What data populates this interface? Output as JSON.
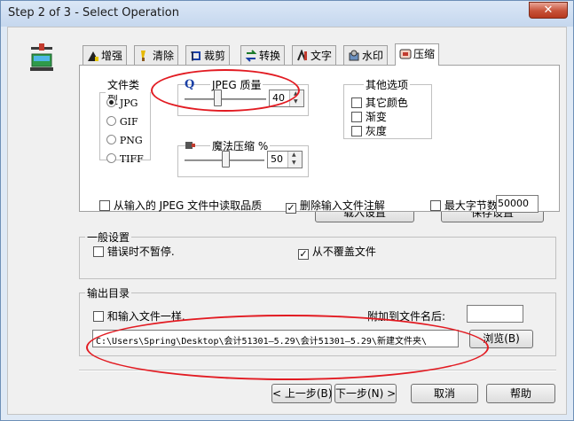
{
  "window": {
    "title": "Step 2 of 3 - Select Operation",
    "close_label": "✕"
  },
  "tabs": [
    {
      "label": "增强",
      "icon": "enhance-icon"
    },
    {
      "label": "清除",
      "icon": "brush-icon"
    },
    {
      "label": "裁剪",
      "icon": "crop-icon"
    },
    {
      "label": "转换",
      "icon": "convert-icon"
    },
    {
      "label": "文字",
      "icon": "text-icon"
    },
    {
      "label": "水印",
      "icon": "watermark-icon"
    },
    {
      "label": "压缩",
      "icon": "compress-icon",
      "active": true
    }
  ],
  "file_type": {
    "legend": "文件类型",
    "options": [
      "JPG",
      "GIF",
      "PNG",
      "TIFF"
    ],
    "selected": "JPG"
  },
  "jpeg_quality": {
    "label": "JPEG 质量",
    "icon_glyph": "Q",
    "value": "40",
    "level_fraction": 0.4
  },
  "magic_compress": {
    "label": "魔法压缩 %",
    "value": "50",
    "level_fraction": 0.5
  },
  "other_options": {
    "legend": "其他选项",
    "items": [
      {
        "label": "其它颜色",
        "checked": false
      },
      {
        "label": "渐变",
        "checked": false
      },
      {
        "label": "灰度",
        "checked": false
      }
    ]
  },
  "read_quality": {
    "label": "从输入的 JPEG 文件中读取品质",
    "checked": false
  },
  "remove_comments": {
    "label": "删除输入文件注解",
    "checked": true
  },
  "max_bytes": {
    "label": "最大字节数",
    "value": "50000",
    "checked": false
  },
  "buttons": {
    "load_settings": "载入设置",
    "save_settings": "保存设置"
  },
  "general": {
    "legend": "一般设置",
    "no_pause": {
      "label": "错误时不暂停.",
      "checked": false
    },
    "no_overwrite": {
      "label": "从不覆盖文件",
      "checked": true
    }
  },
  "output": {
    "legend": "输出目录",
    "same_as_input": {
      "label": "和输入文件一样.",
      "checked": false
    },
    "append_label": "附加到文件名后:",
    "append_value": "",
    "path": "C:\\Users\\Spring\\Desktop\\会计51301—5.29\\会计51301—5.29\\新建文件夹\\",
    "browse_label": "浏览(B)"
  },
  "footer": {
    "back": "< 上一步(B)",
    "next": "下一步(N) >",
    "cancel": "取消",
    "help": "帮助"
  },
  "colors": {
    "annotation": "#e21b22",
    "title_bar": "#c5d7ee",
    "close": "#c75238"
  }
}
